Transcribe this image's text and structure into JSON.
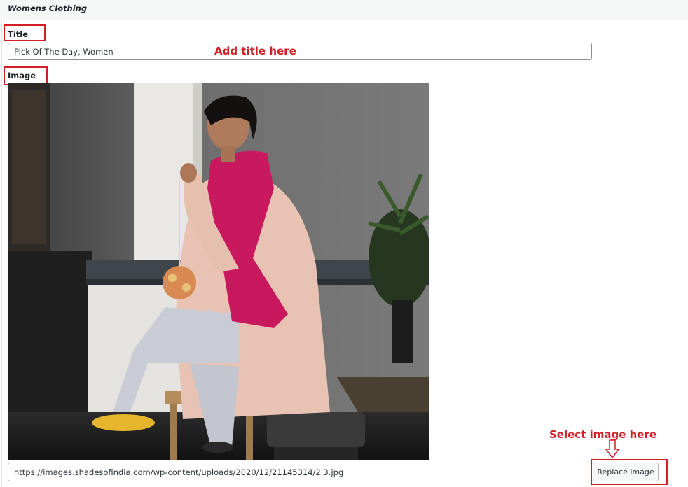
{
  "section": {
    "title": "Womens Clothing"
  },
  "title_field": {
    "label": "Title",
    "value": "Pick Of The Day, Women"
  },
  "image_field": {
    "label": "Image",
    "url": "https://images.shadesofindia.com/wp-content/uploads/2020/12/21145314/2.3.jpg",
    "replace_label": "Replace image"
  },
  "annotations": {
    "add_title": "Add title here",
    "select_image": "Select image here",
    "color": "#d11f25"
  },
  "icons": {
    "annotation_arrow": "down-arrow-icon"
  }
}
